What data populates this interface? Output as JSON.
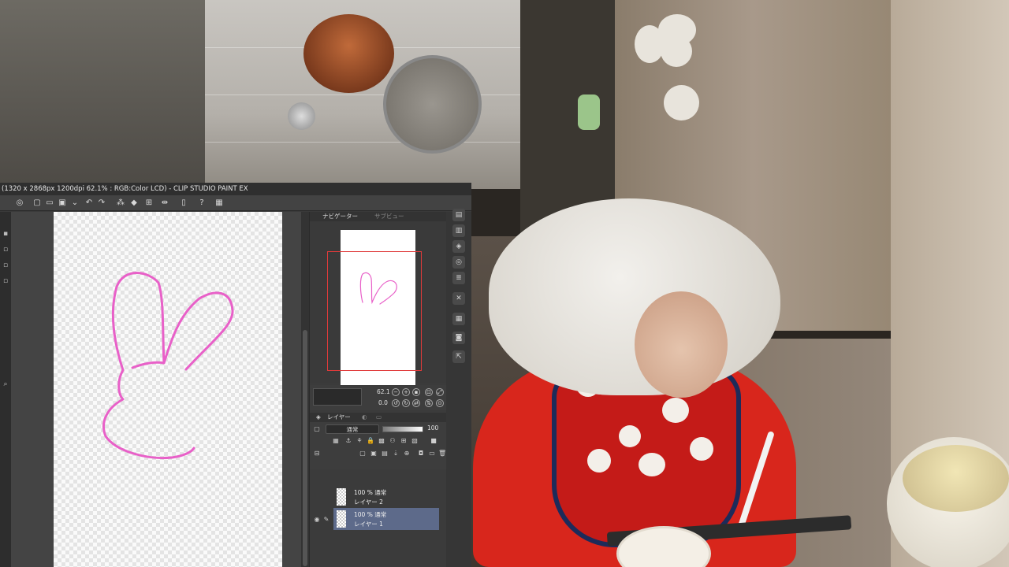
{
  "window": {
    "title": "(1320 x 2868px 1200dpi 62.1% : RGB:Color LCD)  - CLIP STUDIO PAINT EX"
  },
  "toolbar": {
    "icons": [
      "app-menu-icon",
      "new-file-icon",
      "open-file-icon",
      "save-icon",
      "print-icon",
      "undo-icon",
      "redo-icon",
      "clear-icon",
      "fill-icon",
      "transform-icon",
      "flip-icon",
      "companion-icon",
      "help-icon",
      "settings-icon"
    ]
  },
  "navigator": {
    "tab_label": "ナビゲーター",
    "subview_tab_label": "サブビュー",
    "zoom": "62.1",
    "rotation": "0.0"
  },
  "layer_panel": {
    "tab_label": "レイヤー",
    "blend_mode": "通常",
    "opacity": "100",
    "layers": [
      {
        "opacity_mode": "100 %  通常",
        "name": "レイヤー 2",
        "selected": false
      },
      {
        "opacity_mode": "100 %  通常",
        "name": "レイヤー 1",
        "selected": true
      }
    ]
  },
  "canvas": {
    "stroke_color": "#e860c8",
    "drawing": "bunny-sketch"
  },
  "colors": {
    "panel_bg": "#3b3b3b",
    "selected_layer": "#5d6a8a",
    "navigator_frame": "#e03a3a",
    "accent_ring": "#2cd05a"
  }
}
